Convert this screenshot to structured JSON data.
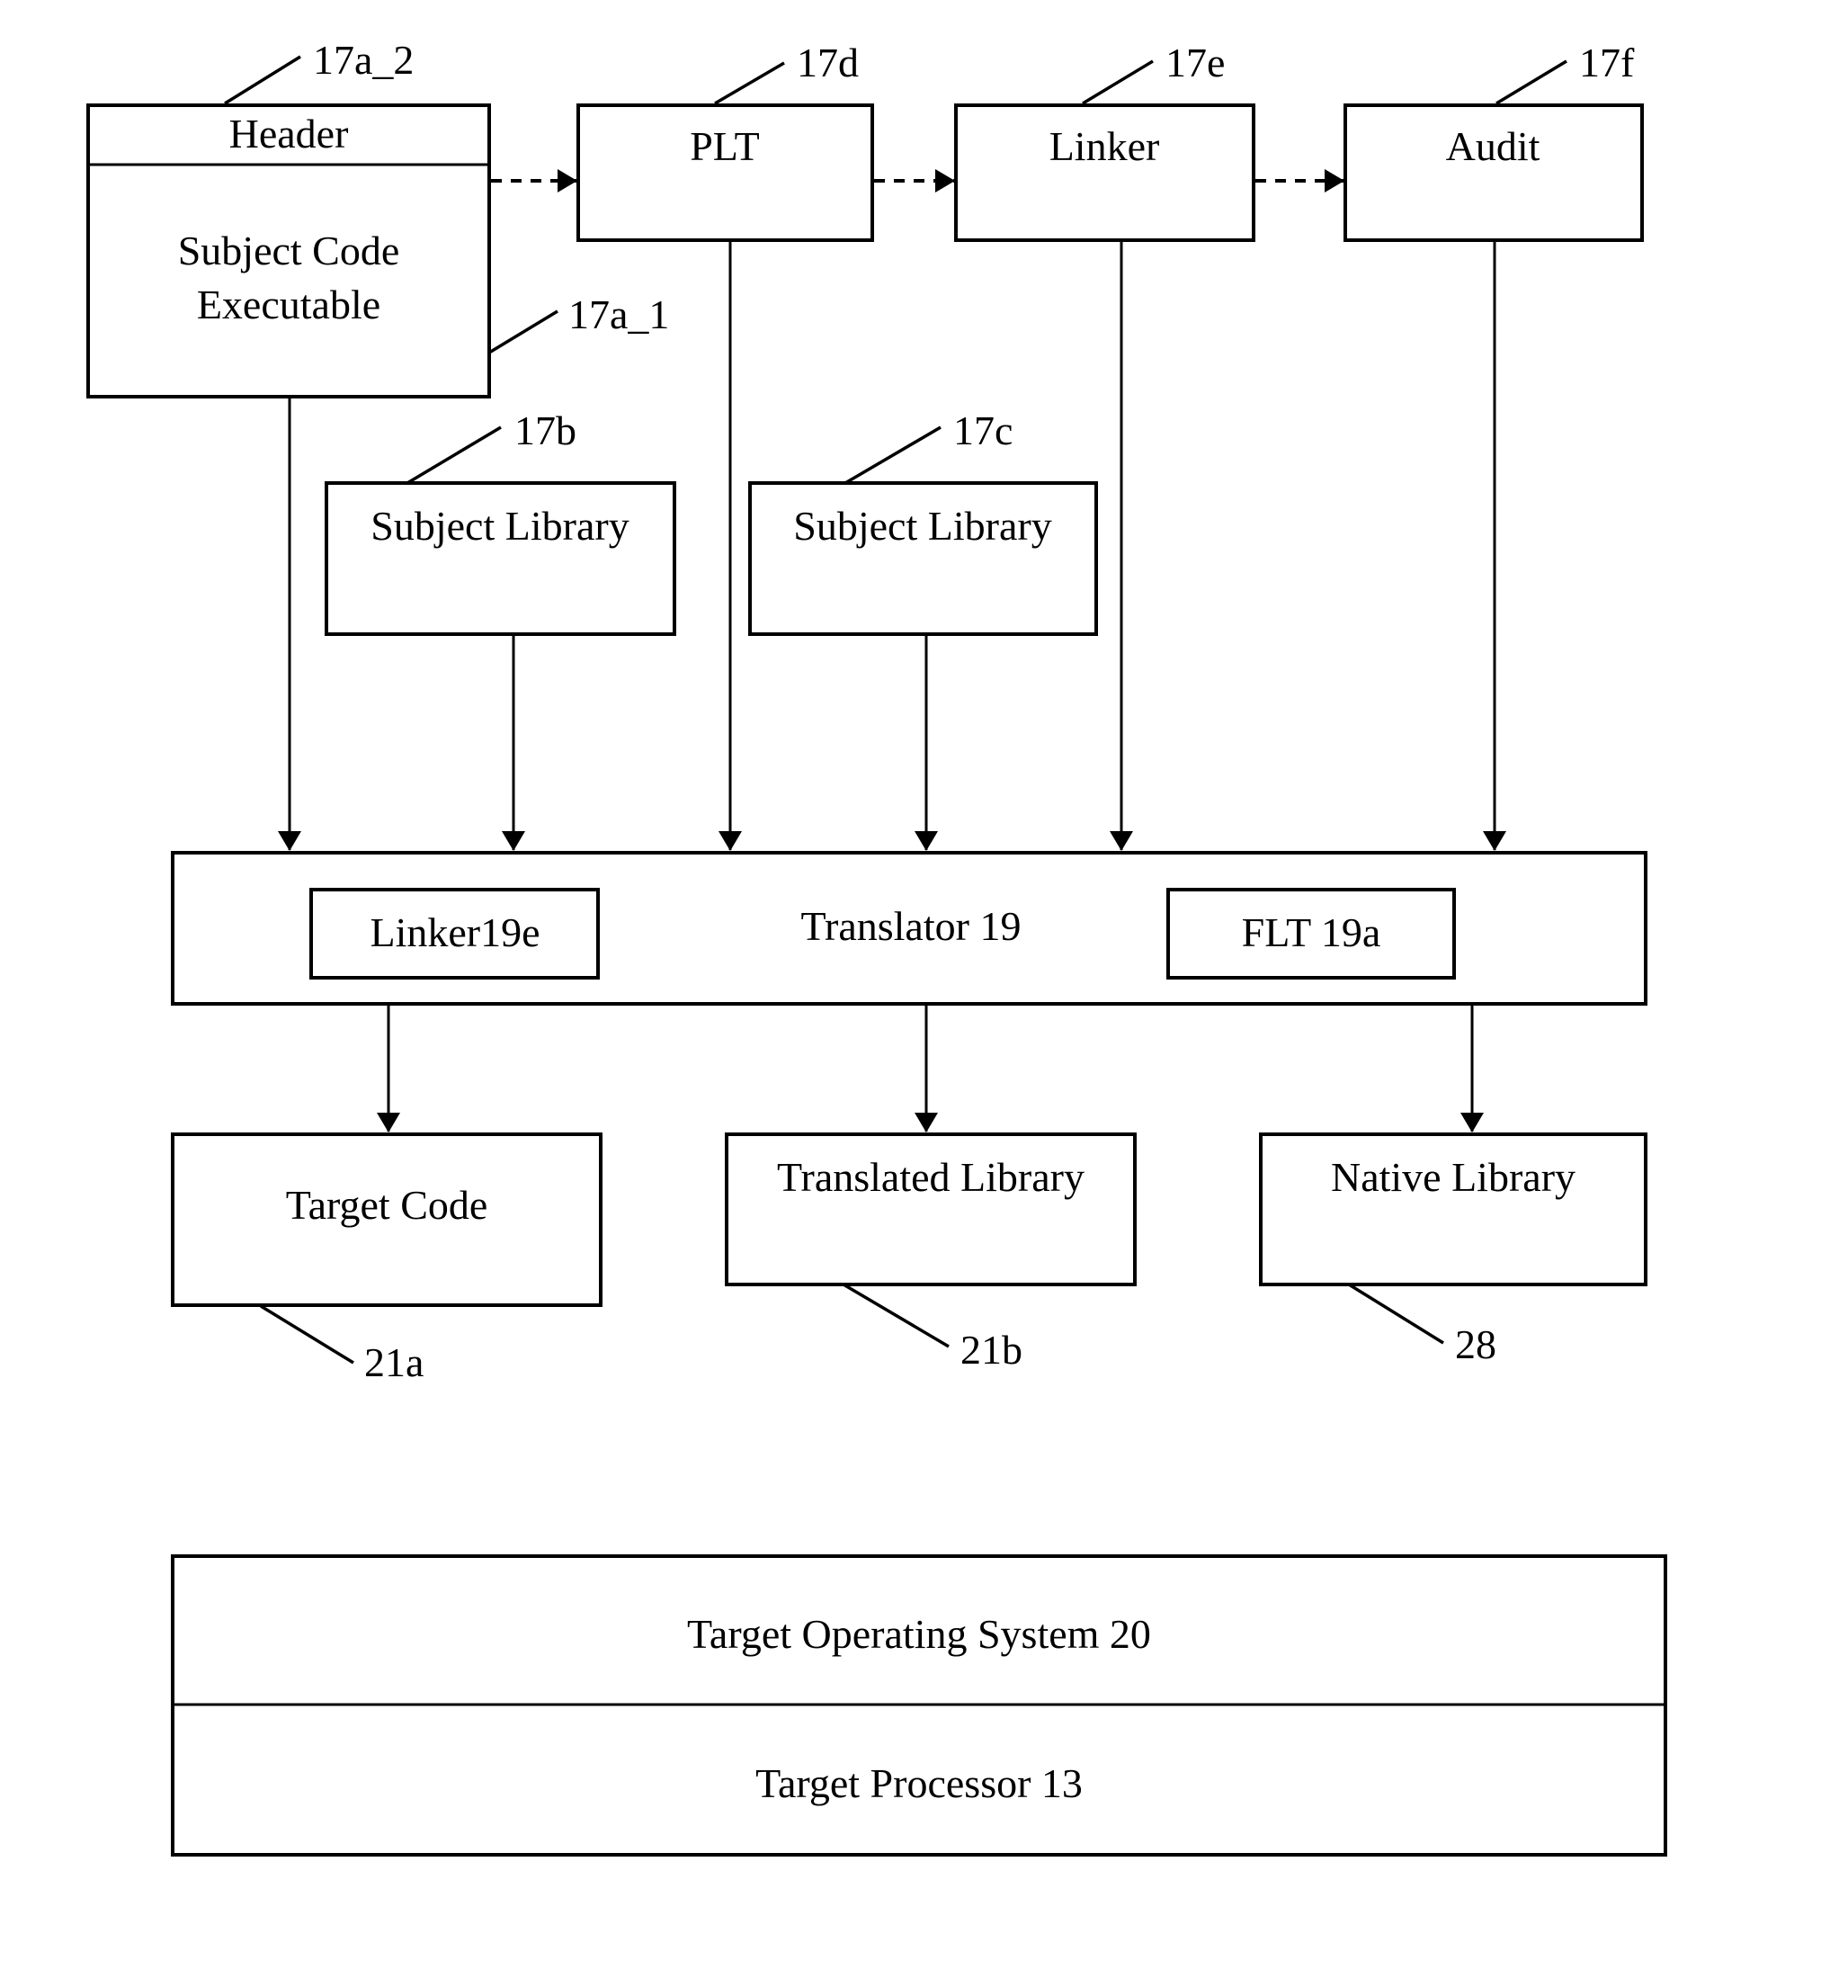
{
  "diagram": {
    "colors": {
      "stroke": "#000000",
      "background": "#ffffff"
    },
    "nodes": {
      "subject_executable": {
        "header_label": "Header",
        "body_line1": "Subject Code",
        "body_line2": "Executable",
        "ref_header": "17a_2",
        "ref_body": "17a_1"
      },
      "plt": {
        "label": "PLT",
        "ref": "17d"
      },
      "linker_top": {
        "label": "Linker",
        "ref": "17e"
      },
      "audit": {
        "label": "Audit",
        "ref": "17f"
      },
      "subject_library_b": {
        "label": "Subject Library",
        "ref": "17b"
      },
      "subject_library_c": {
        "label": "Subject Library",
        "ref": "17c"
      },
      "translator": {
        "label": "Translator 19"
      },
      "translator_linker": {
        "label": "Linker19e"
      },
      "translator_flt": {
        "label": "FLT 19a"
      },
      "target_code": {
        "label": "Target Code",
        "ref": "21a"
      },
      "translated_library": {
        "label": "Translated Library",
        "ref": "21b"
      },
      "native_library": {
        "label": "Native Library",
        "ref": "28"
      },
      "target_os": {
        "label": "Target Operating System 20"
      },
      "target_processor": {
        "label": "Target Processor 13"
      }
    },
    "edges": [
      {
        "from": "subject_executable",
        "to": "plt",
        "style": "dashed"
      },
      {
        "from": "plt",
        "to": "linker_top",
        "style": "dashed"
      },
      {
        "from": "linker_top",
        "to": "audit",
        "style": "dashed"
      },
      {
        "from": "subject_executable",
        "to": "translator",
        "style": "solid"
      },
      {
        "from": "subject_library_b",
        "to": "translator",
        "style": "solid"
      },
      {
        "from": "plt",
        "to": "translator",
        "style": "solid"
      },
      {
        "from": "subject_library_c",
        "to": "translator",
        "style": "solid"
      },
      {
        "from": "linker_top",
        "to": "translator",
        "style": "solid"
      },
      {
        "from": "audit",
        "to": "translator",
        "style": "solid"
      },
      {
        "from": "translator",
        "to": "target_code",
        "style": "solid"
      },
      {
        "from": "translator",
        "to": "translated_library",
        "style": "solid"
      },
      {
        "from": "translator",
        "to": "native_library",
        "style": "solid"
      }
    ]
  }
}
